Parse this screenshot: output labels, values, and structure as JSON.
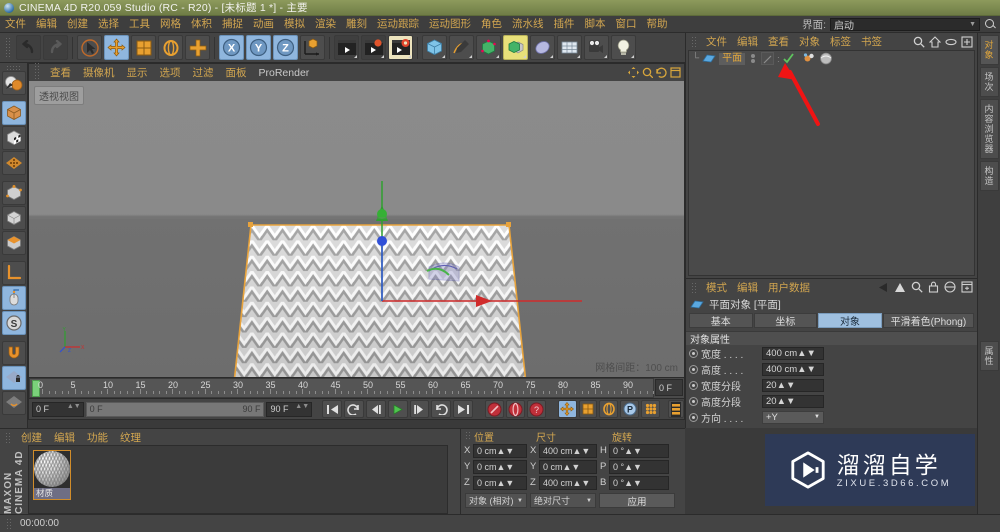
{
  "titlebar": {
    "text": "CINEMA 4D R20.059 Studio (RC - R20) - [未标题 1 *] - 主要",
    "icon": "c4d-logo-icon"
  },
  "menubar": {
    "items": [
      "文件",
      "编辑",
      "创建",
      "选择",
      "工具",
      "网格",
      "体积",
      "捕捉",
      "动画",
      "模拟",
      "渲染",
      "雕刻",
      "运动跟踪",
      "运动图形",
      "角色",
      "流水线",
      "插件",
      "脚本",
      "窗口",
      "帮助"
    ],
    "layout_label": "界面:",
    "layout_value": "启动"
  },
  "toolbar": {
    "buttons": [
      {
        "name": "undo-button",
        "icon": "undo-icon"
      },
      {
        "name": "redo-button",
        "icon": "redo-icon"
      },
      {
        "name": "live-selection-button",
        "icon": "arrow-cursor-icon"
      },
      {
        "name": "move-button",
        "icon": "move-icon"
      },
      {
        "name": "scale-button",
        "icon": "scale-icon"
      },
      {
        "name": "rotate-button",
        "icon": "rotate-icon"
      },
      {
        "name": "plus-tool-button",
        "icon": "plus-icon"
      },
      {
        "name": "x-axis-lock-button",
        "icon": "x-axis-icon"
      },
      {
        "name": "y-axis-lock-button",
        "icon": "y-axis-icon"
      },
      {
        "name": "z-axis-lock-button",
        "icon": "z-axis-icon"
      },
      {
        "name": "world-object-coord-button",
        "icon": "coordinate-cube-icon"
      },
      {
        "name": "render-view-button",
        "icon": "clapperboard-icon"
      },
      {
        "name": "render-picture-viewer-button",
        "icon": "clapperboard-render-icon"
      },
      {
        "name": "render-settings-button",
        "icon": "clapperboard-gear-icon"
      },
      {
        "name": "primitive-cube-button",
        "icon": "blue-cube-icon"
      },
      {
        "name": "spline-pen-button",
        "icon": "pen-spline-icon"
      },
      {
        "name": "generator-button",
        "icon": "green-cube-icon"
      },
      {
        "name": "deformer-button",
        "icon": "green-cube-stack-icon"
      },
      {
        "name": "environment-button",
        "icon": "blob-icon"
      },
      {
        "name": "floor-scene-button",
        "icon": "grid-floor-icon"
      },
      {
        "name": "camera-button",
        "icon": "camera-icon"
      },
      {
        "name": "light-button",
        "icon": "light-bulb-icon"
      }
    ]
  },
  "left_tools": [
    {
      "name": "live-selection-tool",
      "icon": "sphere-cursor-icon"
    },
    {
      "name": "model-mode-tool",
      "icon": "orange-cube-icon"
    },
    {
      "name": "texture-mode-tool",
      "icon": "checker-cube-icon"
    },
    {
      "name": "points-mode-tool",
      "icon": "points-grid-icon"
    },
    {
      "name": "edges-mode-tool",
      "icon": "edges-cube-icon"
    },
    {
      "name": "polygons-mode-tool",
      "icon": "polygon-cube-icon"
    },
    {
      "name": "object-axis-tool",
      "icon": "orange-cap-cube-icon"
    },
    {
      "name": "axis-modify-tool",
      "icon": "axis-l-icon"
    },
    {
      "name": "viewport-solo-tool",
      "icon": "mouse-icon"
    },
    {
      "name": "enable-snapping-tool",
      "icon": "s-circle-icon"
    },
    {
      "name": "magnet-tool",
      "icon": "magnet-icon"
    },
    {
      "name": "workplane-lock-tool",
      "icon": "grid-lock-icon"
    },
    {
      "name": "workplane-tool",
      "icon": "grid-paren-icon"
    }
  ],
  "viewport": {
    "menu": [
      "查看",
      "摄像机",
      "显示",
      "选项",
      "过滤",
      "面板",
      "ProRender"
    ],
    "label": "透视视图",
    "grid_info": "网格间距：100 cm"
  },
  "timeline": {
    "ticks": [
      0,
      5,
      10,
      15,
      20,
      25,
      30,
      35,
      40,
      45,
      50,
      55,
      60,
      65,
      70,
      75,
      80,
      85,
      90
    ],
    "current_frame_field": "0 F",
    "frame_start": "0 F",
    "scrub_start": "0 F",
    "scrub_end": "90 F",
    "frame_end": "90 F",
    "transport": [
      {
        "name": "goto-start-button",
        "icon": "skip-back-icon"
      },
      {
        "name": "previous-key-button",
        "icon": "rewind-key-icon"
      },
      {
        "name": "step-back-button",
        "icon": "step-back-icon"
      },
      {
        "name": "play-button",
        "icon": "play-icon"
      },
      {
        "name": "step-forward-button",
        "icon": "step-forward-icon"
      },
      {
        "name": "next-key-button",
        "icon": "forward-key-icon"
      },
      {
        "name": "goto-end-button",
        "icon": "skip-forward-icon"
      }
    ],
    "record_buttons": [
      {
        "name": "record-active-objects-button",
        "icon": "record-key-icon"
      },
      {
        "name": "autokeying-button",
        "icon": "autokey-icon"
      },
      {
        "name": "keyframe-selection-button",
        "icon": "question-key-icon"
      }
    ],
    "key_toggles": [
      {
        "name": "position-key-toggle",
        "icon": "move-key-icon"
      },
      {
        "name": "scale-key-toggle",
        "icon": "scale-key-icon"
      },
      {
        "name": "rotation-key-toggle",
        "icon": "rotate-key-icon"
      },
      {
        "name": "parameter-key-toggle",
        "icon": "p-key-icon"
      },
      {
        "name": "point-level-animation-toggle",
        "icon": "pla-dots-icon"
      },
      {
        "name": "timeline-toggle",
        "icon": "timeline-bars-icon"
      }
    ]
  },
  "material_manager": {
    "menu": [
      "创建",
      "编辑",
      "功能",
      "纹理"
    ],
    "brand": "MAXON CINEMA 4D",
    "materials": [
      {
        "name": "材质"
      }
    ]
  },
  "coordinates": {
    "headers": [
      "位置",
      "尺寸",
      "旋转"
    ],
    "rows": [
      {
        "pos_label": "X",
        "pos_value": "0 cm",
        "size_label": "X",
        "size_value": "400 cm",
        "rot_label": "H",
        "rot_value": "0 °"
      },
      {
        "pos_label": "Y",
        "pos_value": "0 cm",
        "size_label": "Y",
        "size_value": "0 cm",
        "rot_label": "P",
        "rot_value": "0 °"
      },
      {
        "pos_label": "Z",
        "pos_value": "0 cm",
        "size_label": "Z",
        "size_value": "400 cm",
        "rot_label": "B",
        "rot_value": "0 °"
      }
    ],
    "mode_dropdown": "对象 (相对)",
    "size_dropdown": "绝对尺寸",
    "apply_button": "应用"
  },
  "statusbar": {
    "time": "00:00:00"
  },
  "object_manager": {
    "menu": [
      "文件",
      "编辑",
      "查看",
      "对象",
      "标签",
      "书签"
    ],
    "header_icons": [
      {
        "name": "search-icon"
      },
      {
        "name": "home-icon"
      },
      {
        "name": "eye-icon"
      },
      {
        "name": "new-layer-icon"
      }
    ],
    "objects": [
      {
        "name": "平面",
        "icon": "plane-object-icon",
        "tags": [
          "phong-tag",
          "material-tag"
        ]
      }
    ]
  },
  "attribute_manager": {
    "menu": [
      "模式",
      "编辑",
      "用户数据"
    ],
    "header_icons": [
      {
        "name": "back-arrow-icon"
      },
      {
        "name": "up-arrow-icon"
      },
      {
        "name": "search-icon"
      },
      {
        "name": "lock-icon"
      },
      {
        "name": "eye-toggle-icon"
      },
      {
        "name": "new-window-icon"
      }
    ],
    "title": "平面对象 [平面]",
    "tabs": [
      {
        "label": "基本",
        "active": false
      },
      {
        "label": "坐标",
        "active": false
      },
      {
        "label": "对象",
        "active": true
      },
      {
        "label": "平滑着色(Phong)",
        "active": false
      }
    ],
    "section_title": "对象属性",
    "properties": [
      {
        "label": "宽度 . . . .",
        "value": "400 cm",
        "type": "number"
      },
      {
        "label": "高度 . . . .",
        "value": "400 cm",
        "type": "number"
      },
      {
        "label": "宽度分段",
        "value": "20",
        "type": "number"
      },
      {
        "label": "高度分段",
        "value": "20",
        "type": "number"
      },
      {
        "label": "方向 . . . .",
        "value": "+Y",
        "type": "select"
      }
    ]
  },
  "right_tabs": [
    {
      "label": "对象",
      "active": true
    },
    {
      "label": "场次",
      "active": false
    },
    {
      "label": "内容浏览器",
      "active": false
    },
    {
      "label": "构造",
      "active": false
    },
    {
      "label": "属性",
      "active": false
    }
  ],
  "annotation": {
    "name": "red-arrow-pointer",
    "color": "#f01414"
  },
  "watermark": {
    "cn": "溜溜自学",
    "en": "ZIXUE.3D66.COM",
    "bg": "#2e3a57"
  },
  "colors": {
    "accent_menu": "#d2a650",
    "selection_blue": "#8fb6de",
    "object_orange": "#e0a63c",
    "title_green": "#7d8a50"
  }
}
